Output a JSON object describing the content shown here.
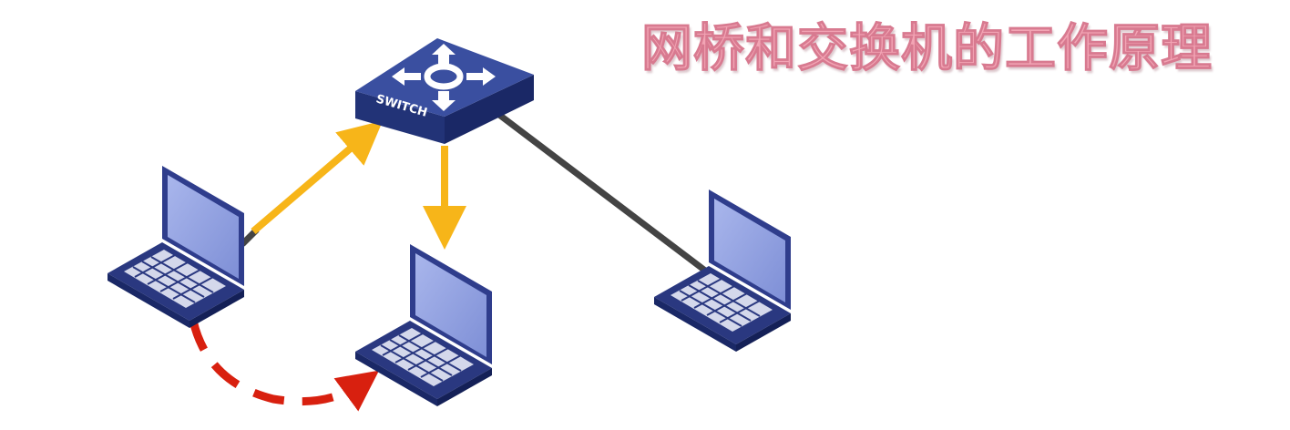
{
  "title": "网桥和交换机的工作原理",
  "switch": {
    "label": "SWITCH",
    "icon": "switch-arrows-icon"
  },
  "devices": [
    {
      "id": "pc-left",
      "icon": "laptop-icon"
    },
    {
      "id": "pc-middle",
      "icon": "laptop-icon"
    },
    {
      "id": "pc-right",
      "icon": "laptop-icon"
    }
  ],
  "links": [
    {
      "from": "pc-left",
      "to": "switch",
      "style": "arrow",
      "color": "#f7b519"
    },
    {
      "from": "switch",
      "to": "pc-middle",
      "style": "arrow",
      "color": "#f7b519"
    },
    {
      "from": "switch",
      "to": "pc-right",
      "style": "line",
      "color": "#444444"
    },
    {
      "from": "pc-left",
      "to": "pc-middle",
      "style": "dashed-arrow",
      "color": "#d8200f"
    }
  ],
  "colors": {
    "switch_top": "#3a4fa0",
    "switch_side": "#223377",
    "laptop_screen": "#8f9fdc",
    "laptop_body": "#2f3d8c",
    "title_fill": "#f2a4b4"
  }
}
